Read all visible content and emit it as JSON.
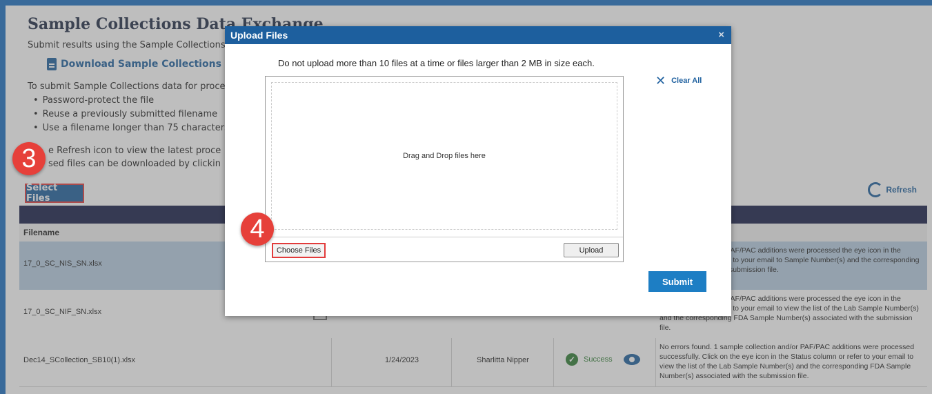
{
  "page": {
    "title": "Sample Collections Data Exchange",
    "intro": "Submit results using the Sample Collections",
    "download_link": "Download Sample Collections Excel T",
    "instruction": "To submit Sample Collections data for proces",
    "bullets": [
      "Password-protect the file",
      "Reuse a previously submitted filename",
      "Use a filename longer than 75 characters"
    ],
    "refresh_line": "e Refresh icon to view the latest proce",
    "processed_line": "sed files can be downloaded by clickin",
    "select_files_label": "Select Files",
    "refresh_label": "Refresh"
  },
  "table": {
    "filename_header": "Filename",
    "rows": [
      {
        "filename": "17_0_SC_NIS_SN.xlsx",
        "date": "",
        "user": "",
        "status": "",
        "message": "ple collection and/or PAF/PAC additions were processed the eye icon in the Status column or refer to your email to Sample Number(s) and the corresponding FDA Sample with the submission file."
      },
      {
        "filename": "17_0_SC_NIF_SN.xlsx",
        "date": "",
        "user": "",
        "status": "",
        "message": "ple collection and/or PAF/PAC additions were processed the eye icon in the Status column or refer to your email to view the list of the Lab Sample Number(s) and the corresponding FDA Sample Number(s) associated with the submission file."
      },
      {
        "filename": "Dec14_SCollection_SB10(1).xlsx",
        "date": "1/24/2023",
        "user": "Sharlitta Nipper",
        "status": "Success",
        "message": "No errors found. 1 sample collection and/or PAF/PAC additions were processed successfully. Click on the eye icon in the Status column or refer to your email to view the list of the Lab Sample Number(s) and the corresponding FDA Sample Number(s) associated with the submission file."
      }
    ]
  },
  "modal": {
    "title": "Upload Files",
    "close": "×",
    "note": "Do not upload more than 10 files at a time or files larger than 2 MB in size each.",
    "drop_text": "Drag and Drop files here",
    "choose_files": "Choose Files",
    "upload": "Upload",
    "clear_all": "Clear All",
    "submit": "Submit"
  },
  "annotations": {
    "step3": "3",
    "step4": "4"
  },
  "colors": {
    "brand_blue": "#1d5f9e",
    "table_header": "#151c48",
    "badge_red": "#e6403a",
    "success_green": "#2e7d32"
  },
  "icons": [
    "document-icon",
    "refresh-icon",
    "check-icon",
    "eye-icon",
    "download-icon",
    "close-icon",
    "clear-x-icon"
  ]
}
